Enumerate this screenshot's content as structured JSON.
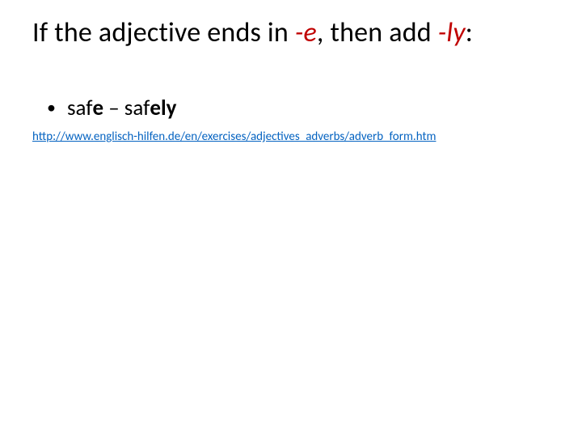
{
  "title": {
    "part1": "If the adjective ends in ",
    "red1": "-e",
    "part2": ", then add ",
    "red2": "-ly",
    "part3": ":"
  },
  "bullet": {
    "pre1": "saf",
    "bold1": "e",
    "mid": " – saf",
    "bold2": "ely"
  },
  "link": {
    "text": "http://www.englisch-hilfen.de/en/exercises/adjectives_adverbs/adverb_form.htm",
    "href": "http://www.englisch-hilfen.de/en/exercises/adjectives_adverbs/adverb_form.htm"
  }
}
